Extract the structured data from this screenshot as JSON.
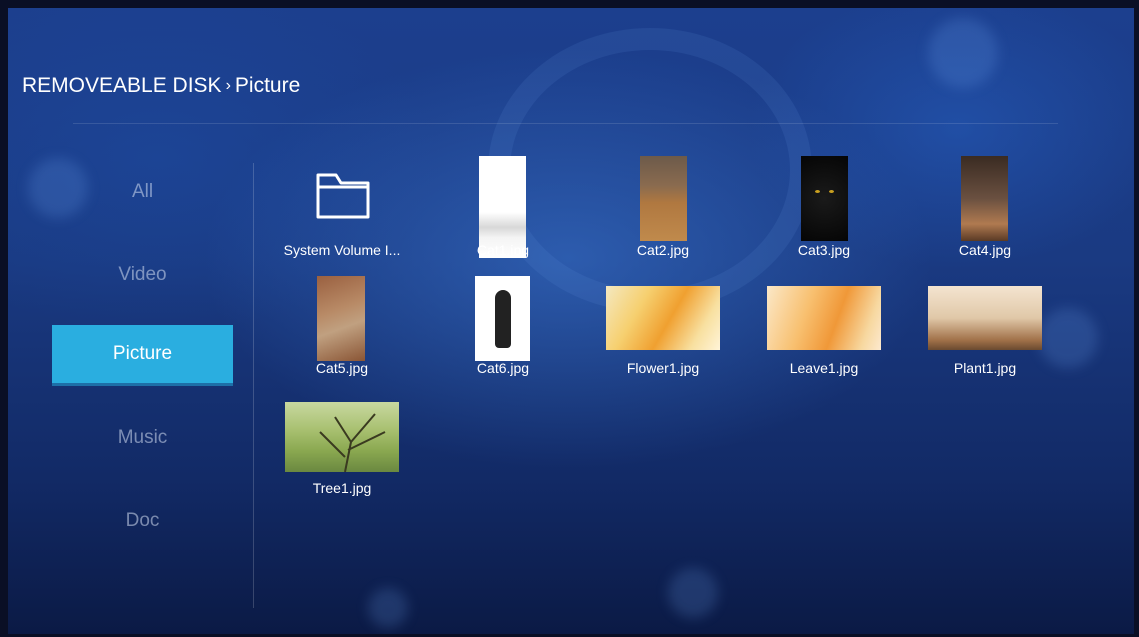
{
  "breadcrumb": {
    "root": "REMOVEABLE DISK",
    "separator": "›",
    "current": "Picture"
  },
  "sidebar": {
    "items": [
      {
        "label": "All",
        "active": false
      },
      {
        "label": "Video",
        "active": false
      },
      {
        "label": "Picture",
        "active": true
      },
      {
        "label": "Music",
        "active": false
      },
      {
        "label": "Doc",
        "active": false
      }
    ]
  },
  "files": [
    {
      "name": "System Volume I...",
      "type": "folder",
      "icon": "folder-icon"
    },
    {
      "name": "Cat1.jpg",
      "type": "image"
    },
    {
      "name": "Cat2.jpg",
      "type": "image"
    },
    {
      "name": "Cat3.jpg",
      "type": "image"
    },
    {
      "name": "Cat4.jpg",
      "type": "image"
    },
    {
      "name": "Cat5.jpg",
      "type": "image"
    },
    {
      "name": "Cat6.jpg",
      "type": "image"
    },
    {
      "name": "Flower1.jpg",
      "type": "image"
    },
    {
      "name": "Leave1.jpg",
      "type": "image"
    },
    {
      "name": "Plant1.jpg",
      "type": "image"
    },
    {
      "name": "Tree1.jpg",
      "type": "image"
    }
  ],
  "colors": {
    "accent": "#2aaee0",
    "background": "#1a3a82"
  }
}
